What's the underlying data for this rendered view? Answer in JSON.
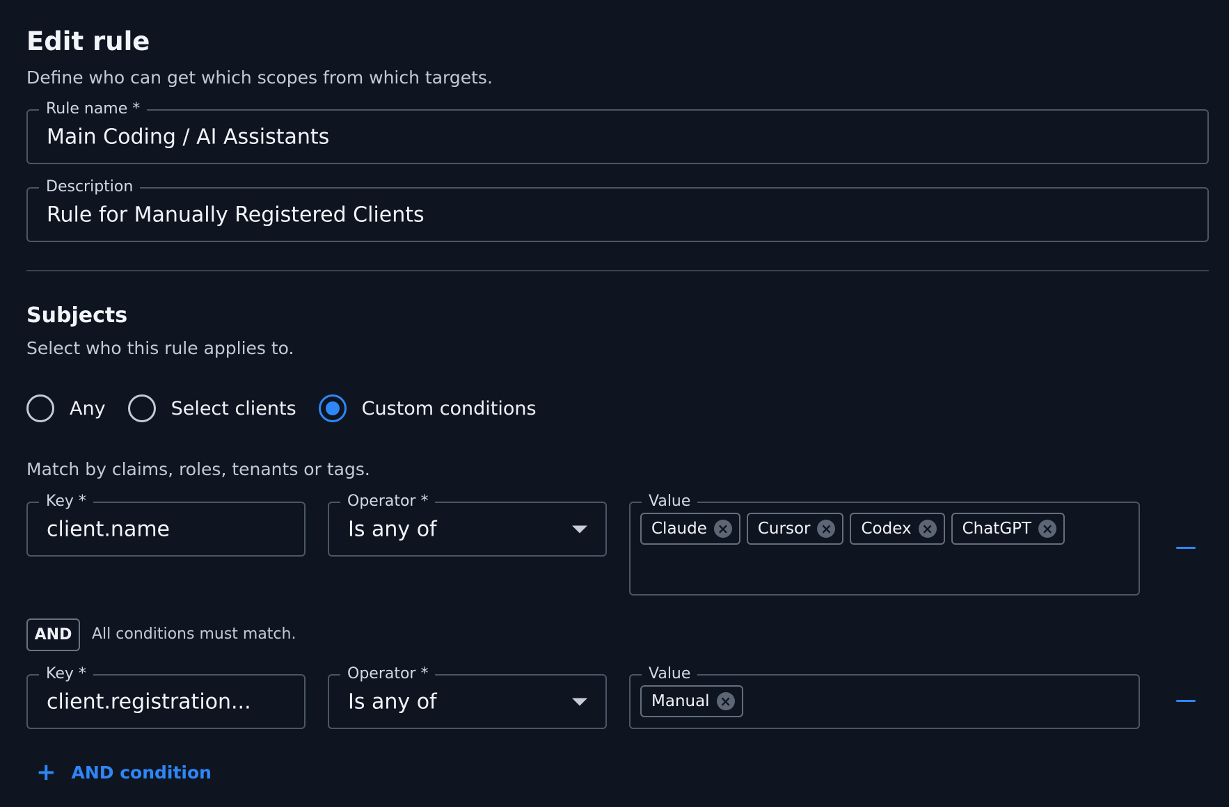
{
  "header": {
    "title": "Edit rule",
    "subtitle": "Define who can get which scopes from which targets."
  },
  "rule_name": {
    "label": "Rule name *",
    "value": "Main Coding / AI Assistants"
  },
  "description": {
    "label": "Description",
    "value": "Rule for Manually Registered Clients"
  },
  "subjects": {
    "title": "Subjects",
    "subtitle": "Select who this rule applies to.",
    "options": [
      {
        "label": "Any",
        "selected": false
      },
      {
        "label": "Select clients",
        "selected": false
      },
      {
        "label": "Custom conditions",
        "selected": true
      }
    ],
    "match_note": "Match by claims, roles, tenants or tags."
  },
  "conditions": [
    {
      "key_label": "Key *",
      "key_value": "client.name",
      "operator_label": "Operator *",
      "operator_value": "Is any of",
      "value_label": "Value",
      "values": [
        "Claude",
        "Cursor",
        "Codex",
        "ChatGPT"
      ]
    },
    {
      "key_label": "Key *",
      "key_value": "client.registration...",
      "operator_label": "Operator *",
      "operator_value": "Is any of",
      "value_label": "Value",
      "values": [
        "Manual"
      ]
    }
  ],
  "connector": {
    "badge": "AND",
    "note": "All conditions must match."
  },
  "add_condition": {
    "label": "AND condition"
  },
  "colors": {
    "background": "#0e1521",
    "accent": "#2f86f6",
    "border": "#4c5666"
  }
}
